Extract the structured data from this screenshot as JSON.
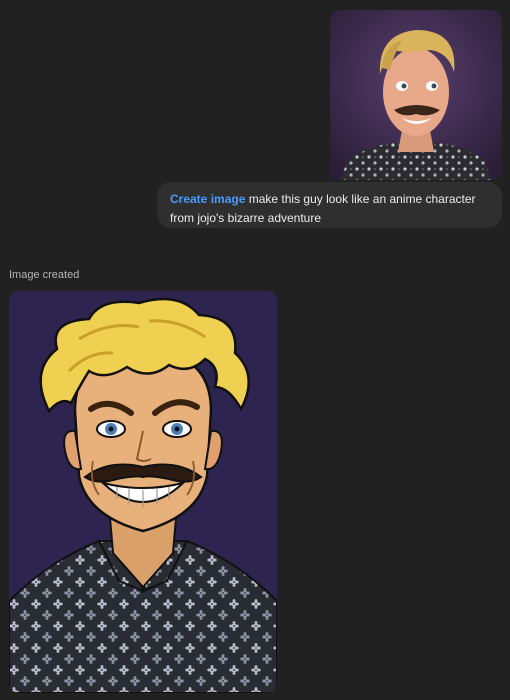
{
  "conversation": {
    "user_message": {
      "photo_alt": "Uploaded photo of a man with blond hair and a mustache",
      "tool_label": "Create image",
      "text": "make this guy look like an anime character from jojo's bizarre adventure"
    },
    "assistant_message": {
      "status": "Image created",
      "image_alt": "Anime-style portrait of a blond man with a mustache in a floral shirt"
    }
  },
  "colors": {
    "background": "#212121",
    "bubble": "#2f2f2f",
    "tool_accent": "#4a9bff",
    "image_backdrop": "#2d2550"
  }
}
